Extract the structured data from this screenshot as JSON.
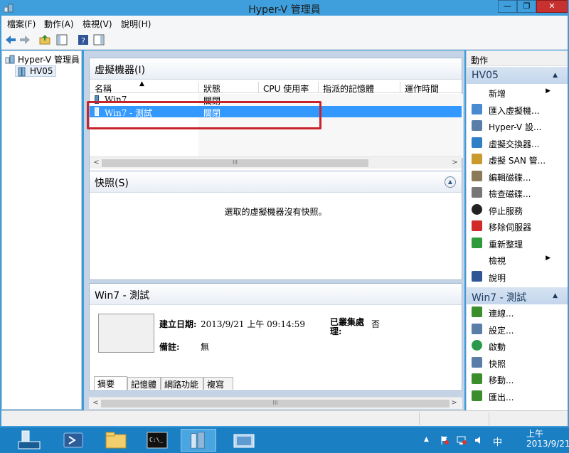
{
  "window": {
    "title": "Hyper-V 管理員",
    "close_glyph": "✕",
    "min_glyph": "—",
    "max_glyph": "❐"
  },
  "menu": [
    "檔案(F)",
    "動作(A)",
    "檢視(V)",
    "說明(H)"
  ],
  "tree": {
    "root": "Hyper-V 管理員",
    "server": "HV05"
  },
  "vm_panel": {
    "title": "虛擬機器(I)",
    "columns": [
      "名稱",
      "狀態",
      "CPU 使用率",
      "指派的記憶體",
      "運作時間"
    ],
    "rows": [
      {
        "name": "Win7",
        "state": "關閉",
        "selected": false
      },
      {
        "name": "Win7 - 測試",
        "state": "關閉",
        "selected": true
      }
    ],
    "scroll_left": "<",
    "scroll_right": ">",
    "scroll_thumb": "III"
  },
  "snapshot_panel": {
    "title": "快照(S)",
    "empty_text": "選取的虛擬機器沒有快照。",
    "collapse_glyph": "▲"
  },
  "detail_panel": {
    "title": "Win7 - 測試",
    "created_label": "建立日期:",
    "created_value": "2013/9/21 上午 09:14:59",
    "clustered_label": "已叢集處\n理:",
    "clustered_value": "否",
    "notes_label": "備註:",
    "notes_value": "無",
    "tabs": [
      "摘要",
      "記憶體",
      "網路功能",
      "複寫"
    ]
  },
  "center_scroll": {
    "left": "<",
    "right": ">",
    "thumb": "III"
  },
  "actions": {
    "title": "動作",
    "server_section": "HV05",
    "server_items": [
      {
        "label": "新增",
        "icon": "blank",
        "submenu": true
      },
      {
        "label": "匯入虛擬機...",
        "icon": "import-icon"
      },
      {
        "label": "Hyper-V 設...",
        "icon": "settings-icon"
      },
      {
        "label": "虛擬交換器...",
        "icon": "switch-icon"
      },
      {
        "label": "虛擬 SAN 管...",
        "icon": "san-icon"
      },
      {
        "label": "編輯磁碟...",
        "icon": "edit-disk-icon"
      },
      {
        "label": "檢查磁碟...",
        "icon": "inspect-disk-icon"
      },
      {
        "label": "停止服務",
        "icon": "stop-icon"
      },
      {
        "label": "移除伺服器",
        "icon": "remove-icon"
      },
      {
        "label": "重新整理",
        "icon": "refresh-icon"
      },
      {
        "label": "檢視",
        "icon": "blank",
        "submenu": true
      },
      {
        "label": "說明",
        "icon": "help-icon"
      }
    ],
    "vm_section": "Win7 - 測試",
    "vm_items": [
      {
        "label": "連線...",
        "icon": "connect-icon"
      },
      {
        "label": "設定...",
        "icon": "settings-icon"
      },
      {
        "label": "啟動",
        "icon": "start-icon"
      },
      {
        "label": "快照",
        "icon": "snapshot-icon"
      },
      {
        "label": "移動...",
        "icon": "move-icon"
      },
      {
        "label": "匯出...",
        "icon": "export-icon"
      }
    ],
    "submenu_glyph": "▶",
    "collapse_glyph": "▲"
  },
  "taskbar": {
    "ime": "中",
    "clock_line1": "上午",
    "clock_line2": "2013/9/21"
  },
  "colors": {
    "accent": "#3e9fdc",
    "selection": "#3399ff",
    "highlight_box": "#c8232b",
    "taskbar": "#1b7fc4"
  }
}
